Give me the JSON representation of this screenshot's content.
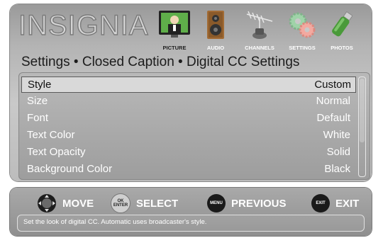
{
  "brand": {
    "logo_text": "INSIGNIA"
  },
  "nav": {
    "items": [
      {
        "label": "PICTURE",
        "icon": "picture-icon",
        "active": true
      },
      {
        "label": "AUDIO",
        "icon": "speaker-icon",
        "active": false
      },
      {
        "label": "CHANNELS",
        "icon": "antenna-icon",
        "active": false
      },
      {
        "label": "SETTINGS",
        "icon": "gears-icon",
        "active": false
      },
      {
        "label": "PHOTOS",
        "icon": "usb-drive-icon",
        "active": false
      }
    ]
  },
  "breadcrumb": "Settings • Closed Caption • Digital CC Settings",
  "menu": {
    "rows": [
      {
        "label": "Style",
        "value": "Custom",
        "selected": true
      },
      {
        "label": "Size",
        "value": "Normal"
      },
      {
        "label": "Font",
        "value": "Default"
      },
      {
        "label": "Text Color",
        "value": "White"
      },
      {
        "label": "Text Opacity",
        "value": "Solid"
      },
      {
        "label": "Background Color",
        "value": "Black"
      }
    ]
  },
  "hints": [
    {
      "key": "move",
      "icon": "dpad-icon",
      "icon_text": "",
      "label": "MOVE"
    },
    {
      "key": "select",
      "icon": "ok-enter-icon",
      "icon_text": "OK\nENTER",
      "label": "SELECT"
    },
    {
      "key": "previous",
      "icon": "menu-button-icon",
      "icon_text": "MENU",
      "label": "PREVIOUS"
    },
    {
      "key": "exit",
      "icon": "exit-button-icon",
      "icon_text": "EXIT",
      "label": "EXIT"
    }
  ],
  "help_text": "Set the look of digital CC. Automatic uses broadcaster's style.",
  "colors": {
    "panel_gradient_top": "#9a9a9a",
    "panel_gradient_bottom": "#c9c9c9",
    "selected_row": "#d9d9d9",
    "text_light": "#ffffff",
    "text_dark": "#1c1c1c"
  }
}
